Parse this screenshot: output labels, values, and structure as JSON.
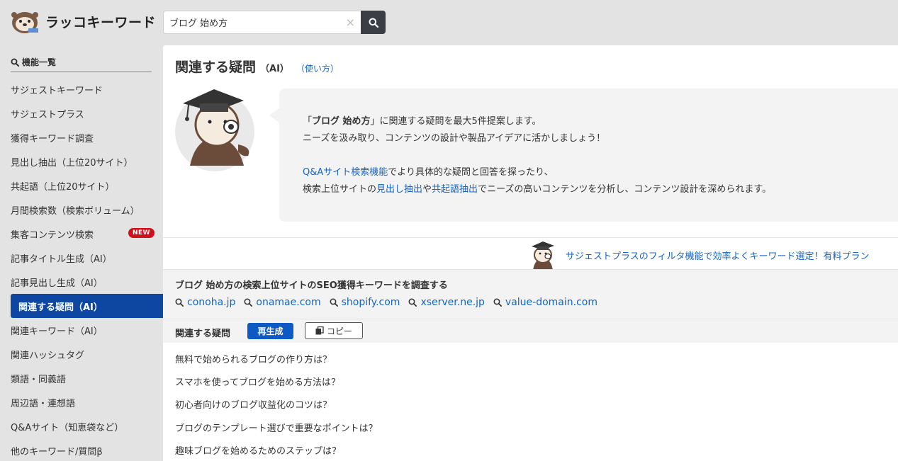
{
  "app": {
    "name": "ラッコキーワード"
  },
  "search": {
    "value": "ブログ 始め方",
    "clear_symbol": "×"
  },
  "sidebar": {
    "heading": "機能一覧",
    "items": [
      {
        "label": "サジェストキーワード"
      },
      {
        "label": "サジェストプラス"
      },
      {
        "label": "獲得キーワード調査"
      },
      {
        "label": "見出し抽出（上位20サイト）"
      },
      {
        "label": "共起語（上位20サイト）"
      },
      {
        "label": "月間検索数（検索ボリューム）"
      },
      {
        "label": "集客コンテンツ検索",
        "badge": "NEW"
      },
      {
        "label": "記事タイトル生成（AI）"
      },
      {
        "label": "記事見出し生成（AI）"
      },
      {
        "label": "関連する疑問（AI）",
        "active": true
      },
      {
        "label": "関連キーワード（AI）"
      },
      {
        "label": "関連ハッシュタグ"
      },
      {
        "label": "類語・同義語"
      },
      {
        "label": "周辺語・連想語"
      },
      {
        "label": "Q&Aサイト（知恵袋など）"
      },
      {
        "label": "他のキーワード/質問β"
      }
    ]
  },
  "main": {
    "title": "関連する疑問",
    "title_suffix": "（AI）",
    "how_to_link": "（使い方）",
    "intro": {
      "open_quote": "「",
      "keyword": "ブログ 始め方",
      "line1_rest": "」に関連する疑問を最大5件提案します。",
      "line2": "ニーズを汲み取り、コンテンツの設計や製品アイデアに活かしましょう！",
      "qa_link": "Q&Aサイト検索機能",
      "line3_rest": "でより具体的な疑問と回答を探ったり、",
      "line4_pre": "検索上位サイトの",
      "headings_link": "見出し抽出",
      "line4_mid": "や",
      "cooccur_link": "共起語抽出",
      "line4_rest": "でニーズの高いコンテンツを分析し、コンテンツ設計を深められます。"
    },
    "promo_link": "サジェストプラスのフィルタ機能で効率よくキーワード選定！有料プラン",
    "seo": {
      "title": "ブログ 始め方の検索上位サイトのSEO獲得キーワードを調査する",
      "sites": [
        "conoha.jp",
        "onamae.com",
        "shopify.com",
        "xserver.ne.jp",
        "value-domain.com"
      ]
    },
    "questions": {
      "heading": "関連する疑問",
      "regen_label": "再生成",
      "copy_label": "コピー",
      "items": [
        "無料で始められるブログの作り方は？",
        "スマホを使ってブログを始める方法は？",
        "初心者向けのブログ収益化のコツは？",
        "ブログのテンプレート選びで重要なポイントは？",
        "趣味ブログを始めるためのステップは？"
      ]
    }
  },
  "colors": {
    "accent": "#0d47a1",
    "link": "#1565c0",
    "badge": "#d0101b",
    "button": "#0d5ac5"
  }
}
